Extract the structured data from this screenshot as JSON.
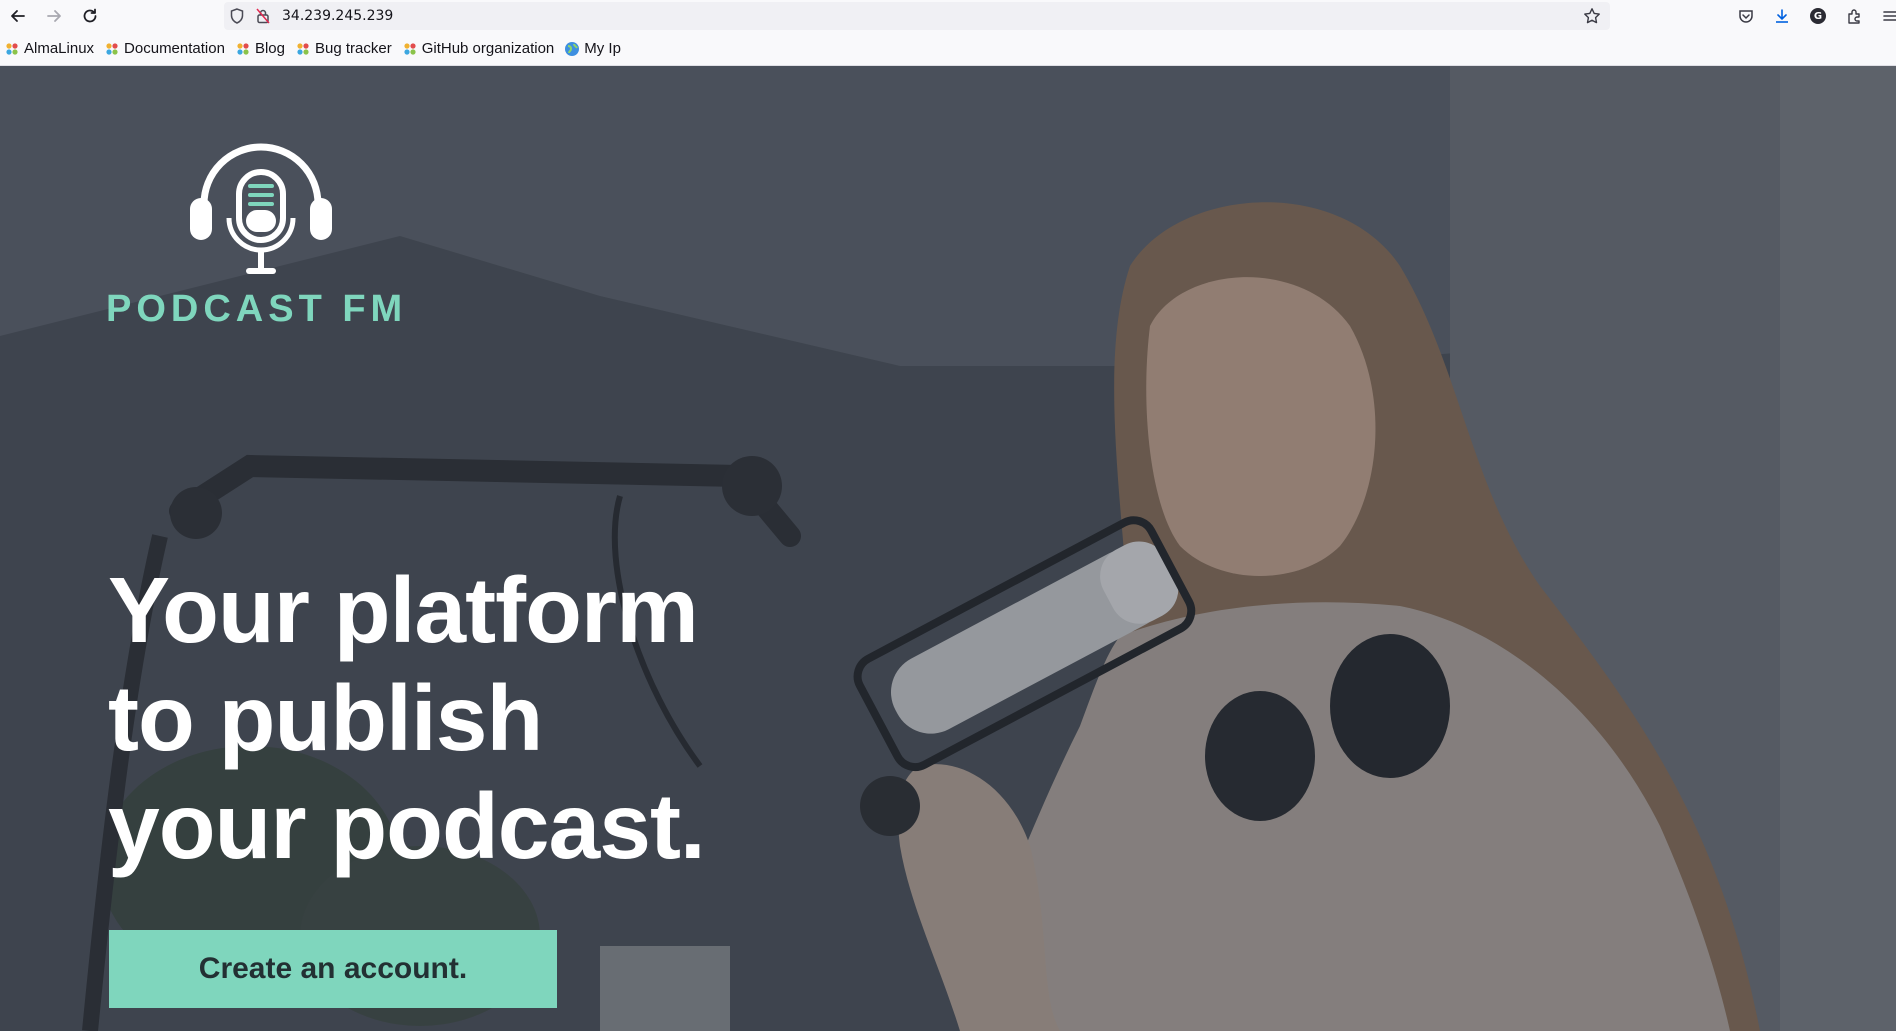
{
  "browser": {
    "url": "34.239.245.239",
    "nav_icons": [
      "back-arrow-icon",
      "forward-arrow-icon",
      "reload-icon"
    ],
    "right_icons": [
      "pocket-icon",
      "download-icon",
      "account-icon",
      "extensions-icon",
      "menu-icon"
    ],
    "account_initial": "G"
  },
  "bookmarks": [
    {
      "label": "AlmaLinux",
      "icon": "almalinux-icon"
    },
    {
      "label": "Documentation",
      "icon": "almalinux-icon"
    },
    {
      "label": "Blog",
      "icon": "almalinux-icon"
    },
    {
      "label": "Bug tracker",
      "icon": "almalinux-icon"
    },
    {
      "label": "GitHub organization",
      "icon": "almalinux-icon"
    },
    {
      "label": "My Ip",
      "icon": "globe-icon"
    }
  ],
  "hero": {
    "brand": "PODCAST FM",
    "headline_lines": [
      "Your platform",
      "to publish",
      "your podcast."
    ],
    "cta_label": "Create an account.",
    "colors": {
      "accent": "#7fd6bd",
      "cta_text": "#233033",
      "headline": "#ffffff"
    }
  }
}
